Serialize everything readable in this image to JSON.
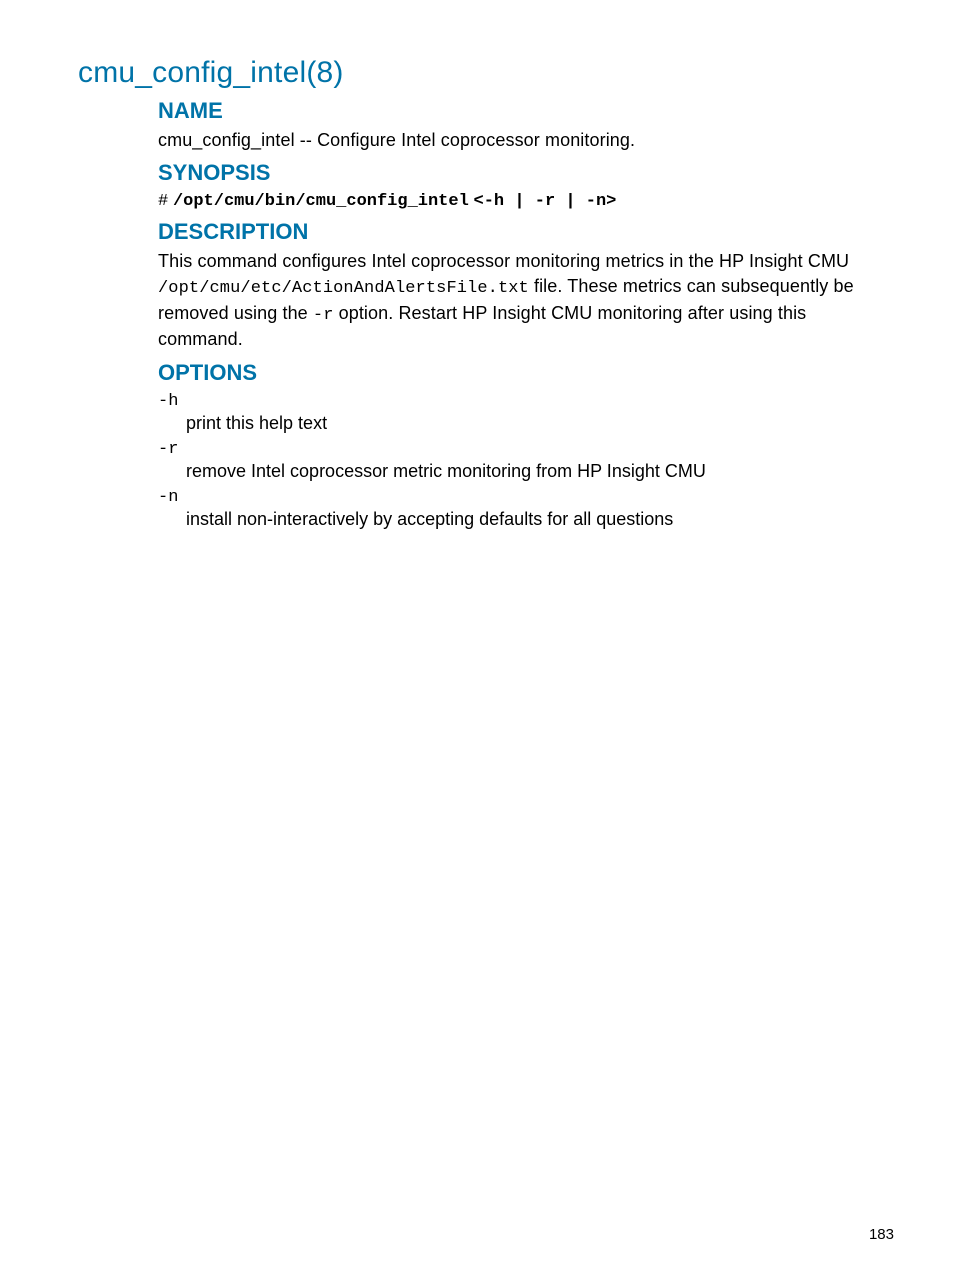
{
  "title": "cmu_config_intel(8)",
  "sections": {
    "name": {
      "heading": "NAME",
      "text": "cmu_config_intel -- Configure Intel coprocessor monitoring."
    },
    "synopsis": {
      "heading": "SYNOPSIS",
      "hash": "#",
      "cmd": "/opt/cmu/bin/cmu_config_intel",
      "args": "<-h | -r | -n>"
    },
    "description": {
      "heading": "DESCRIPTION",
      "part1": "This command configures Intel coprocessor monitoring metrics in the HP Insight CMU ",
      "path1": "/opt/cmu/etc/ActionAndAlertsFile.txt",
      "part2": " file. These metrics can subsequently be removed using the ",
      "flag": "-r",
      "part3": " option. Restart HP Insight CMU monitoring after using this command."
    },
    "options": {
      "heading": "OPTIONS",
      "items": [
        {
          "flag": "-h",
          "desc": "print this help text"
        },
        {
          "flag": "-r",
          "desc": "remove Intel coprocessor metric monitoring from HP Insight CMU"
        },
        {
          "flag": "-n",
          "desc": "install non-interactively by accepting defaults for all questions"
        }
      ]
    }
  },
  "page_number": "183"
}
